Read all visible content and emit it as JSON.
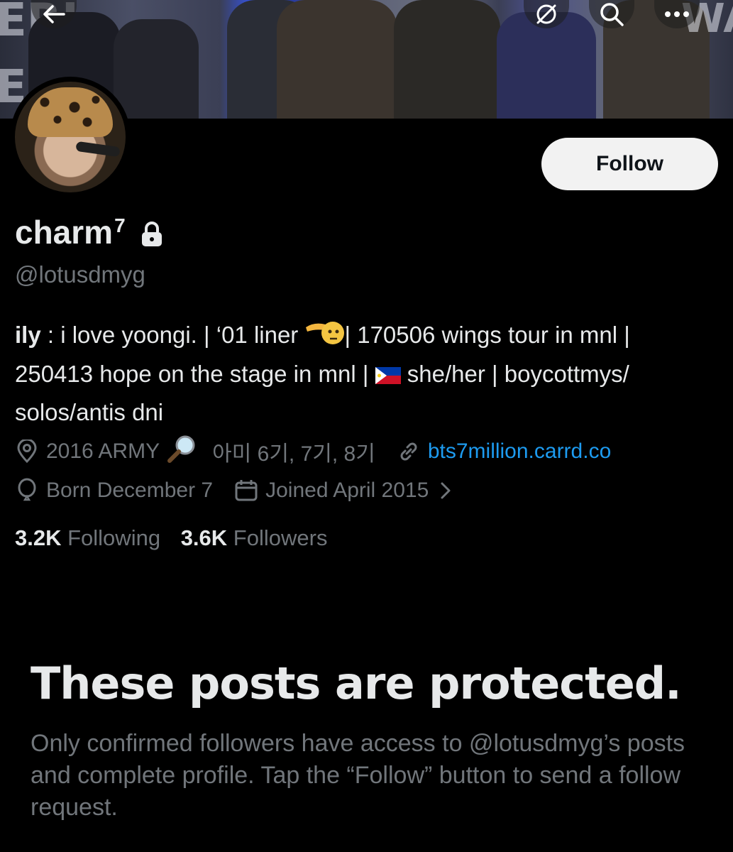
{
  "header": {
    "back_icon": "arrow-left-icon",
    "action_icons": [
      "hide-icon",
      "search-icon",
      "more-icon"
    ]
  },
  "profile": {
    "name": "charm",
    "name_sup": "7",
    "handle": "@lotusdmyg",
    "follow_label": "Follow",
    "bio": {
      "bold_prefix": "ily",
      "line_1_rest": " : i love yoongi. | ‘01 liner ",
      "line_1_tail": "| 170506 wings tour in mnl |",
      "line_2": "250413 hope on the stage in mnl | ",
      "line_2_tail": " she/her | boycottmys/",
      "line_3": "solos/antis dni"
    },
    "location": "2016 ARMY",
    "location_extra": "아미 6기, 7기, 8기",
    "website": "bts7million.carrd.co",
    "birthday": "Born December 7",
    "joined": "Joined April 2015",
    "following_count": "3.2K",
    "following_label": "Following",
    "followers_count": "3.6K",
    "followers_label": "Followers"
  },
  "protected": {
    "title": "These posts are protected.",
    "body": "Only confirmed followers have access to @lotusdmyg’s posts and complete profile. Tap the “Follow” button to send a follow request."
  },
  "colors": {
    "background": "#000000",
    "text_primary": "#e7e9ea",
    "text_secondary": "#71767b",
    "link": "#1d9bf0",
    "follow_button_bg": "#f2f2f2"
  }
}
